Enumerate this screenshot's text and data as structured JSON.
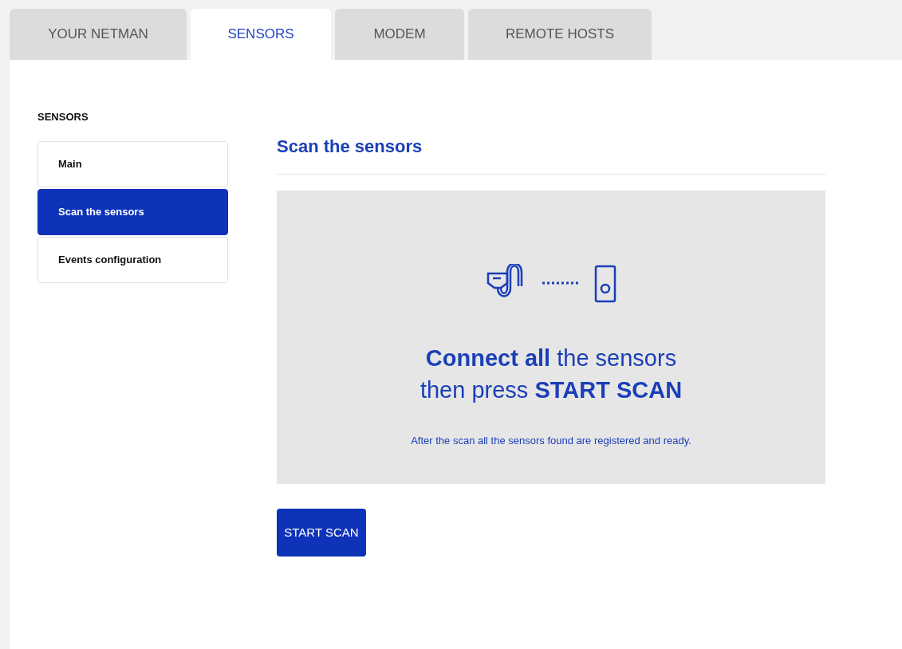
{
  "tabs": [
    {
      "label": "YOUR NETMAN",
      "selected": false
    },
    {
      "label": "SENSORS",
      "selected": true
    },
    {
      "label": "MODEM",
      "selected": false
    },
    {
      "label": "REMOTE HOSTS",
      "selected": false
    }
  ],
  "sidebar": {
    "title": "SENSORS",
    "items": [
      {
        "label": "Main",
        "selected": false
      },
      {
        "label": "Scan the sensors",
        "selected": true
      },
      {
        "label": "Events configuration",
        "selected": false
      }
    ]
  },
  "main": {
    "heading": "Scan the sensors",
    "headline": [
      "**Connect all** the sensors",
      "then press **START SCAN**"
    ],
    "note": "After the scan all the sensors found are registered and ready.",
    "button": "START SCAN"
  }
}
